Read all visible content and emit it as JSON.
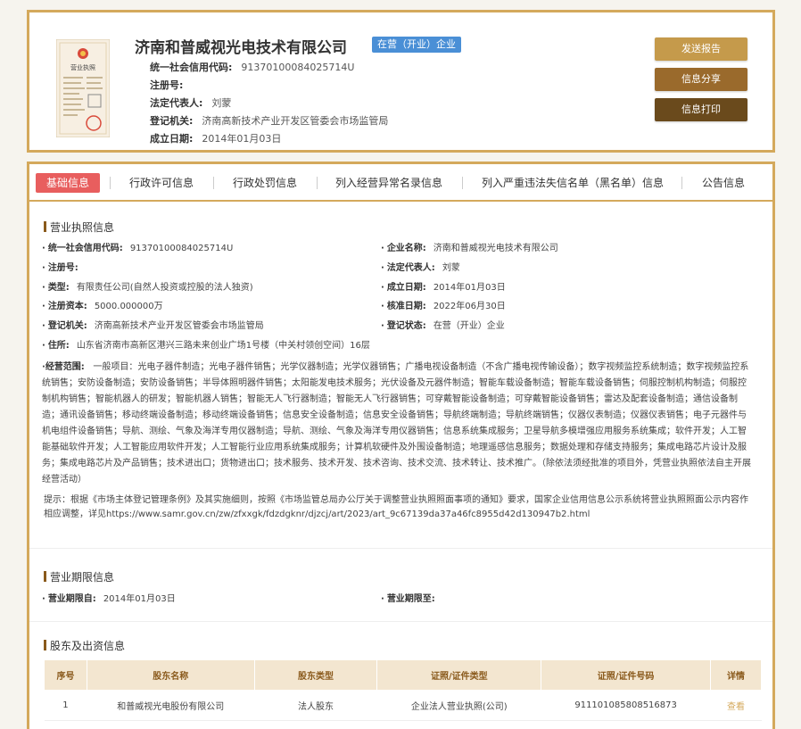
{
  "company": {
    "name": "济南和普威视光电技术有限公司",
    "status_tag": "在营（开业）企业",
    "license_image_text": "营业执照"
  },
  "top_info": [
    {
      "label": "统一社会信用代码:",
      "value": "91370100084025714U"
    },
    {
      "label": "注册号:",
      "value": ""
    },
    {
      "label": "法定代表人:",
      "value": "刘蒙"
    },
    {
      "label": "登记机关:",
      "value": "济南高新技术产业开发区管委会市场监管局"
    },
    {
      "label": "成立日期:",
      "value": "2014年01月03日"
    }
  ],
  "buttons": {
    "send": "发送报告",
    "share": "信息分享",
    "print": "信息打印"
  },
  "tabs": [
    "基础信息",
    "行政许可信息",
    "行政处罚信息",
    "列入经营异常名录信息",
    "列入严重违法失信名单（黑名单）信息",
    "公告信息"
  ],
  "sections": {
    "license": "营业执照信息",
    "period": "营业期限信息",
    "shareholders": "股东及出资信息"
  },
  "license_fields": {
    "credit_code": {
      "label": "统一社会信用代码:",
      "value": "91370100084025714U"
    },
    "company_name": {
      "label": "企业名称:",
      "value": "济南和普威视光电技术有限公司"
    },
    "reg_no": {
      "label": "注册号:",
      "value": ""
    },
    "legal_rep": {
      "label": "法定代表人:",
      "value": "刘蒙"
    },
    "type": {
      "label": "类型:",
      "value": "有限责任公司(自然人投资或控股的法人独资)"
    },
    "est_date": {
      "label": "成立日期:",
      "value": "2014年01月03日"
    },
    "capital": {
      "label": "注册资本:",
      "value": "5000.000000万"
    },
    "approve_date": {
      "label": "核准日期:",
      "value": "2022年06月30日"
    },
    "authority": {
      "label": "登记机关:",
      "value": "济南高新技术产业开发区管委会市场监管局"
    },
    "reg_status": {
      "label": "登记状态:",
      "value": "在营（开业）企业"
    },
    "address": {
      "label": "住所:",
      "value": "山东省济南市高新区港兴三路未来创业广场1号楼（中关村领创空间）16层"
    }
  },
  "scope": {
    "label": "经营范围:",
    "value": "一般项目：光电子器件制造；光电子器件销售；光学仪器制造；光学仪器销售；广播电视设备制造（不含广播电视传输设备）；数字视频监控系统制造；数字视频监控系统销售；安防设备制造；安防设备销售；半导体照明器件销售；太阳能发电技术服务；光伏设备及元器件制造；智能车载设备制造；智能车载设备销售；伺服控制机构制造；伺服控制机构销售；智能机器人的研发；智能机器人销售；智能无人飞行器制造；智能无人飞行器销售；可穿戴智能设备制造；可穿戴智能设备销售；雷达及配套设备制造；通信设备制造；通讯设备销售；移动终端设备制造；移动终端设备销售；信息安全设备制造；信息安全设备销售；导航终端制造；导航终端销售；仪器仪表制造；仪器仪表销售；电子元器件与机电组件设备销售；导航、测绘、气象及海洋专用仪器制造；导航、测绘、气象及海洋专用仪器销售；信息系统集成服务；卫星导航多模增强应用服务系统集成；软件开发；人工智能基础软件开发；人工智能应用软件开发；人工智能行业应用系统集成服务；计算机软硬件及外围设备制造；地理遥感信息服务；数据处理和存储支持服务；集成电路芯片设计及服务；集成电路芯片及产品销售；技术进出口；货物进出口；技术服务、技术开发、技术咨询、技术交流、技术转让、技术推广。（除依法须经批准的项目外，凭营业执照依法自主开展经营活动）"
  },
  "notice": "提示：根据《市场主体登记管理条例》及其实施细则，按照《市场监管总局办公厅关于调整营业执照照面事项的通知》要求，国家企业信用信息公示系统将营业执照照面公示内容作相应调整，详见https://www.samr.gov.cn/zw/zfxxgk/fdzdgknr/djzcj/art/2023/art_9c67139da37a46fc8955d42d130947b2.html",
  "period": {
    "from": {
      "label": "营业期限自:",
      "value": "2014年01月03日"
    },
    "to": {
      "label": "营业期限至:",
      "value": ""
    }
  },
  "shareholder_table": {
    "headers": [
      "序号",
      "股东名称",
      "股东类型",
      "证照/证件类型",
      "证照/证件号码",
      "详情"
    ],
    "rows": [
      [
        "1",
        "和普威视光电股份有限公司",
        "法人股东",
        "企业法人营业执照(公司)",
        "911101085808516873",
        "查看"
      ]
    ]
  },
  "colors": {
    "border_gold": "#d4a95c",
    "status_blue": "#4a8fd6",
    "tab_active_red": "#e85e5e",
    "btn_send": "#c59a4b",
    "btn_share": "#9a6a2c",
    "btn_print": "#6a4a1c"
  }
}
